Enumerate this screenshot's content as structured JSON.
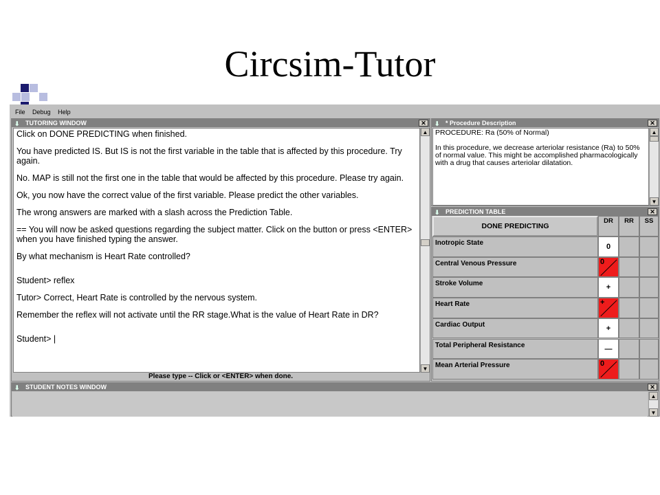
{
  "slide": {
    "title": "Circsim-Tutor"
  },
  "menubar": {
    "items": [
      "File",
      "Debug",
      "Help"
    ]
  },
  "tutoring": {
    "title": "TUTORING WINDOW",
    "messages": [
      "   Click on DONE PREDICTING when finished.",
      "You have predicted IS. But IS is not the first variable in the table that is affected by this procedure. Try again.",
      "No. MAP is still not the first one in the table that would be affected by this procedure. Please try again.",
      "Ok, you now have the correct value of the first variable. Please predict the other variables.",
      "The wrong answers are marked with a slash across the Prediction Table.",
      "== You will now be asked questions regarding the subject matter. Click on the button or press <ENTER> when you have finished typing the answer.",
      "By what mechanism is Heart Rate controlled?",
      "",
      "Student> reflex",
      "Tutor> Correct, Heart Rate is controlled by the nervous system.",
      "Remember the reflex will not activate until the RR stage.What is the value of Heart Rate in DR?",
      "",
      "Student> |"
    ],
    "status": "Please type -- Click or <ENTER> when done."
  },
  "procedure": {
    "title": "* Procedure Description",
    "line1": "PROCEDURE:   Ra (50% of Normal)",
    "body": "In this procedure, we decrease arteriolar resistance (Ra) to 50% of normal value.  This might be accomplished pharmacologically with a drug that causes arteriolar dilatation."
  },
  "prediction": {
    "title": "PREDICTION TABLE",
    "done_label": "DONE PREDICTING",
    "columns": [
      "DR",
      "RR",
      "SS"
    ],
    "rows": [
      {
        "name": "Inotropic State",
        "dr": "0",
        "wrong": false
      },
      {
        "name": "Central Venous Pressure",
        "dr": "0",
        "wrong": true
      },
      {
        "name": "Stroke Volume",
        "dr": "+",
        "wrong": false
      },
      {
        "name": "Heart Rate",
        "dr": "+",
        "wrong": true
      },
      {
        "name": "Cardiac Output",
        "dr": "+",
        "wrong": false
      },
      {
        "name": "Total Peripheral Resistance",
        "dr": "—",
        "wrong": false
      },
      {
        "name": "Mean Arterial Pressure",
        "dr": "0",
        "wrong": true
      }
    ],
    "wrong_color": "#ee1c1c"
  },
  "notes": {
    "title": "STUDENT NOTES WINDOW"
  },
  "icons": {
    "close": "close-icon",
    "scroll_up": "arrow-up-icon",
    "scroll_down": "arrow-down-icon",
    "window": "window-icon"
  }
}
